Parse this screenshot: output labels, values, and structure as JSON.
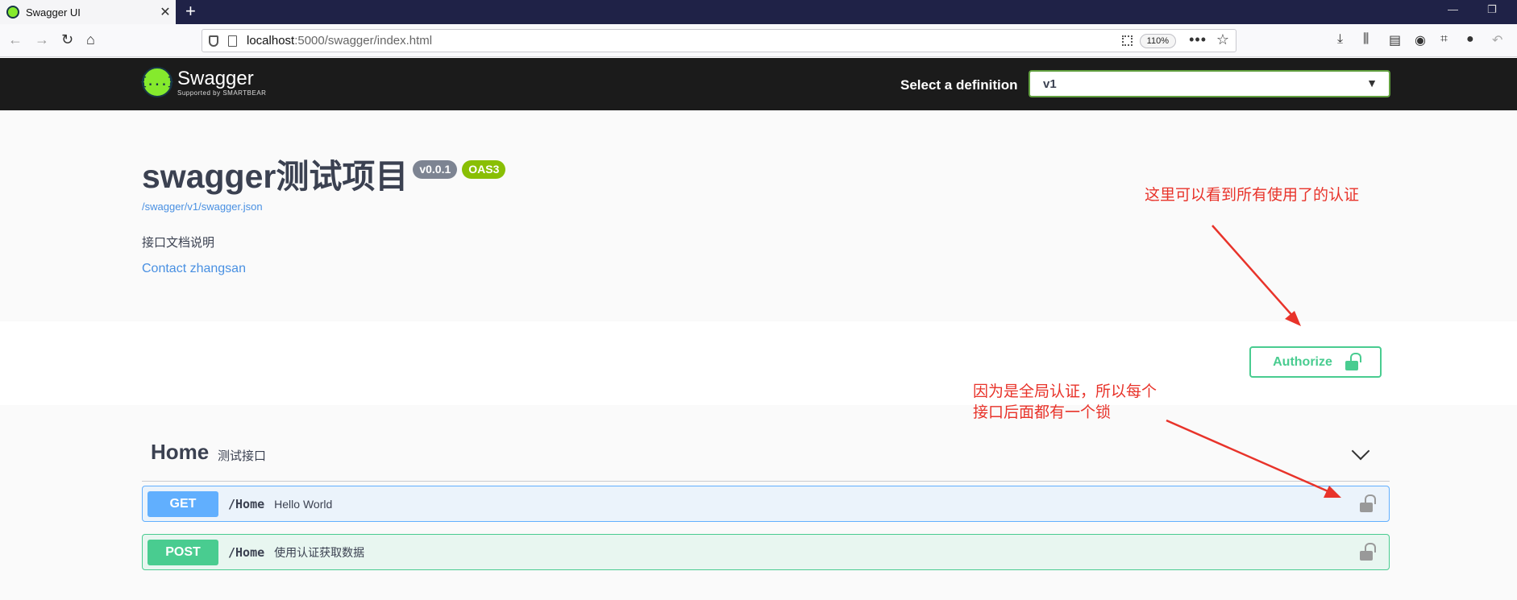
{
  "browser": {
    "tab_title": "Swagger UI",
    "tab_close": "✕",
    "new_tab": "+",
    "url_host": "localhost",
    "url_rest": ":5000/swagger/index.html",
    "zoom": "110%",
    "more": "•••",
    "star": "☆",
    "back": "←",
    "forward": "→",
    "reload": "↻",
    "home": "⌂",
    "minimize": "—",
    "restore": "❐",
    "toolbar_icons": [
      "download-icon",
      "library-icon",
      "sidebar-icon",
      "account-icon",
      "screenshot-icon",
      "chat-icon",
      "undo-icon"
    ]
  },
  "swagger": {
    "logo_mark": "{...}",
    "logo_name": "Swagger",
    "logo_sub": "Supported by SMARTBEAR",
    "definition_label": "Select a definition",
    "definition_value": "v1"
  },
  "info": {
    "title": "swagger测试项目",
    "version_badge": "v0.0.1",
    "oas_badge": "OAS3",
    "spec_link": "/swagger/v1/swagger.json",
    "description": "接口文档说明",
    "contact": "Contact zhangsan"
  },
  "scheme": {
    "authorize_label": "Authorize"
  },
  "tag": {
    "name": "Home",
    "description": "测试接口"
  },
  "operations": [
    {
      "method": "GET",
      "path": "/Home",
      "summary": "Hello World"
    },
    {
      "method": "POST",
      "path": "/Home",
      "summary": "使用认证获取数据"
    }
  ],
  "annotations": {
    "note_top": "这里可以看到所有使用了的认证",
    "note_mid_line1": "因为是全局认证，所以每个",
    "note_mid_line2": "接口后面都有一个锁"
  },
  "colors": {
    "get": "#61affe",
    "post": "#49cc90",
    "annotation": "#e8332a",
    "topbar": "#1b1b1b"
  }
}
